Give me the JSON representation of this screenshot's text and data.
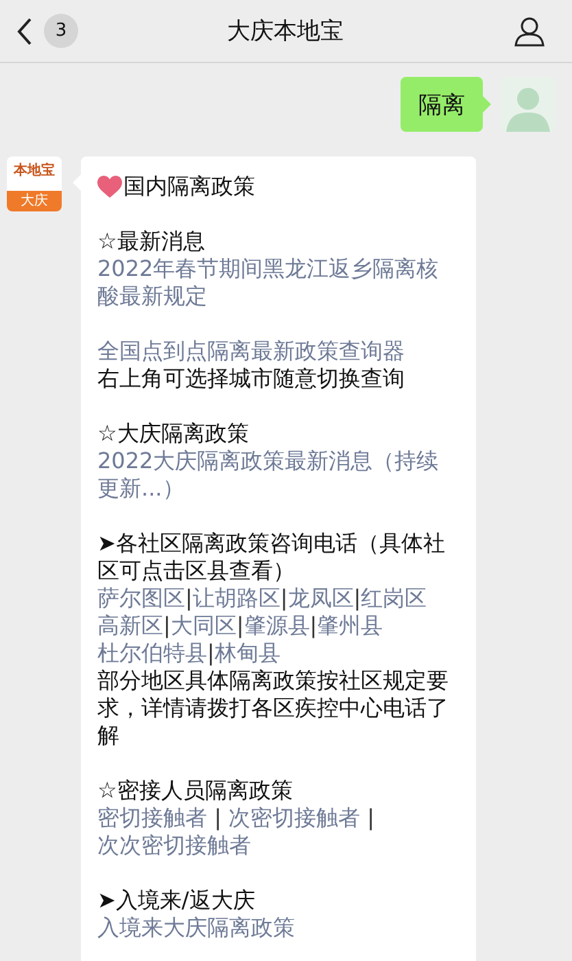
{
  "header": {
    "back_badge": "3",
    "title": "大庆本地宝"
  },
  "sent": {
    "text": "隔离"
  },
  "sender": {
    "logo_top": "本地宝",
    "logo_bottom": "大庆"
  },
  "message": {
    "title": "国内隔离政策",
    "paragraphs": [
      {
        "lines": [
          {
            "kind": "heading",
            "text": "☆最新消息"
          },
          {
            "kind": "link",
            "text": "2022年春节期间黑龙江返乡隔离核酸最新规定"
          }
        ]
      },
      {
        "lines": [
          {
            "kind": "link",
            "text": "全国点到点隔离最新政策查询器"
          },
          {
            "kind": "text",
            "text": "右上角可选择城市随意切换查询"
          }
        ]
      },
      {
        "lines": [
          {
            "kind": "heading",
            "text": "☆大庆隔离政策"
          },
          {
            "kind": "link",
            "text": "2022大庆隔离政策最新消息（持续更新...）"
          }
        ]
      },
      {
        "lines": [
          {
            "kind": "heading",
            "text": "➤各社区隔离政策咨询电话（具体社区可点击区县查看）"
          },
          {
            "kind": "links",
            "sep": "|",
            "items": [
              "萨尔图区",
              "让胡路区",
              "龙凤区",
              "红岗区"
            ]
          },
          {
            "kind": "links",
            "sep": "|",
            "items": [
              "高新区",
              "大同区",
              "肇源县",
              "肇州县"
            ]
          },
          {
            "kind": "links",
            "sep": "|",
            "items": [
              "杜尔伯特县",
              "林甸县"
            ]
          },
          {
            "kind": "text",
            "text": "部分地区具体隔离政策按社区规定要求，详情请拨打各区疾控中心电话了解"
          }
        ]
      },
      {
        "lines": [
          {
            "kind": "heading",
            "text": "☆密接人员隔离政策"
          },
          {
            "kind": "links",
            "sep": " | ",
            "items": [
              "密切接触者",
              "次密切接触者",
              "次次密切接触者"
            ]
          }
        ]
      },
      {
        "lines": [
          {
            "kind": "heading",
            "text": "➤入境来/返大庆"
          },
          {
            "kind": "link",
            "text": "入境来大庆隔离政策"
          }
        ]
      }
    ]
  }
}
